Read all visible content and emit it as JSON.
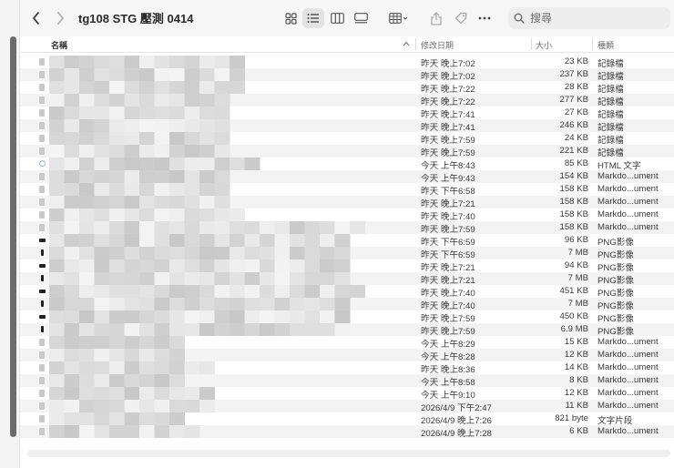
{
  "window": {
    "title": "tg108 STG 壓測 0414"
  },
  "search": {
    "placeholder": "搜尋"
  },
  "columns": {
    "name": "名稱",
    "date": "修改日期",
    "size": "大小",
    "kind": "種類"
  },
  "files": [
    {
      "date": "昨天 晚上7:02",
      "size": "23 KB",
      "kind": "記錄檔",
      "icon": "text-document-icon"
    },
    {
      "date": "昨天 晚上7:02",
      "size": "237 KB",
      "kind": "記錄檔",
      "icon": "text-document-icon"
    },
    {
      "date": "昨天 晚上7:22",
      "size": "28 KB",
      "kind": "記錄檔",
      "icon": "text-document-icon"
    },
    {
      "date": "昨天 晚上7:22",
      "size": "277 KB",
      "kind": "記錄檔",
      "icon": "text-document-icon"
    },
    {
      "date": "昨天 晚上7:41",
      "size": "27 KB",
      "kind": "記錄檔",
      "icon": "text-document-icon"
    },
    {
      "date": "昨天 晚上7:41",
      "size": "246 KB",
      "kind": "記錄檔",
      "icon": "text-document-icon"
    },
    {
      "date": "昨天 晚上7:59",
      "size": "24 KB",
      "kind": "記錄檔",
      "icon": "text-document-icon"
    },
    {
      "date": "昨天 晚上7:59",
      "size": "221 KB",
      "kind": "記錄檔",
      "icon": "text-document-icon"
    },
    {
      "date": "今天 上午8:43",
      "size": "85 KB",
      "kind": "HTML 文字",
      "icon": "html-document-icon"
    },
    {
      "date": "今天 上午9:43",
      "size": "154 KB",
      "kind": "Markdo...ument",
      "icon": "text-document-icon"
    },
    {
      "date": "昨天 下午6:58",
      "size": "158 KB",
      "kind": "Markdo...ument",
      "icon": "text-document-icon"
    },
    {
      "date": "昨天 晚上7:21",
      "size": "158 KB",
      "kind": "Markdo...ument",
      "icon": "text-document-icon"
    },
    {
      "date": "昨天 晚上7:40",
      "size": "158 KB",
      "kind": "Markdo...ument",
      "icon": "text-document-icon"
    },
    {
      "date": "昨天 晚上7:59",
      "size": "158 KB",
      "kind": "Markdo...ument",
      "icon": "text-document-icon"
    },
    {
      "date": "昨天 下午6:59",
      "size": "96 KB",
      "kind": "PNG影像",
      "icon": "png-image-icon"
    },
    {
      "date": "昨天 下午6:59",
      "size": "7 MB",
      "kind": "PNG影像",
      "icon": "png-image-icon"
    },
    {
      "date": "昨天 晚上7:21",
      "size": "94 KB",
      "kind": "PNG影像",
      "icon": "png-image-icon"
    },
    {
      "date": "昨天 晚上7:21",
      "size": "7 MB",
      "kind": "PNG影像",
      "icon": "png-image-icon"
    },
    {
      "date": "昨天 晚上7:40",
      "size": "451 KB",
      "kind": "PNG影像",
      "icon": "png-image-icon"
    },
    {
      "date": "昨天 晚上7:40",
      "size": "7 MB",
      "kind": "PNG影像",
      "icon": "png-image-icon"
    },
    {
      "date": "昨天 晚上7:59",
      "size": "450 KB",
      "kind": "PNG影像",
      "icon": "png-image-icon"
    },
    {
      "date": "昨天 晚上7:59",
      "size": "6.9 MB",
      "kind": "PNG影像",
      "icon": "png-image-icon"
    },
    {
      "date": "今天 上午8:29",
      "size": "15 KB",
      "kind": "Markdo...ument",
      "icon": "text-document-icon"
    },
    {
      "date": "今天 上午8:28",
      "size": "12 KB",
      "kind": "Markdo...ument",
      "icon": "text-document-icon"
    },
    {
      "date": "昨天 晚上8:36",
      "size": "14 KB",
      "kind": "Markdo...ument",
      "icon": "text-document-icon"
    },
    {
      "date": "今天 上午8:58",
      "size": "8 KB",
      "kind": "Markdo...ument",
      "icon": "text-document-icon"
    },
    {
      "date": "今天 上午9:10",
      "size": "12 KB",
      "kind": "Markdo...ument",
      "icon": "text-document-icon"
    },
    {
      "date": "2026/4/9 下午2:47",
      "size": "11 KB",
      "kind": "Markdo...ument",
      "icon": "text-document-icon"
    },
    {
      "date": "2026/4/9 晚上7:26",
      "size": "821 byte",
      "kind": "文字片段",
      "icon": "text-document-icon"
    },
    {
      "date": "2026/4/9 晚上7:28",
      "size": "6 KB",
      "kind": "Markdo...ument",
      "icon": "text-document-icon"
    }
  ]
}
